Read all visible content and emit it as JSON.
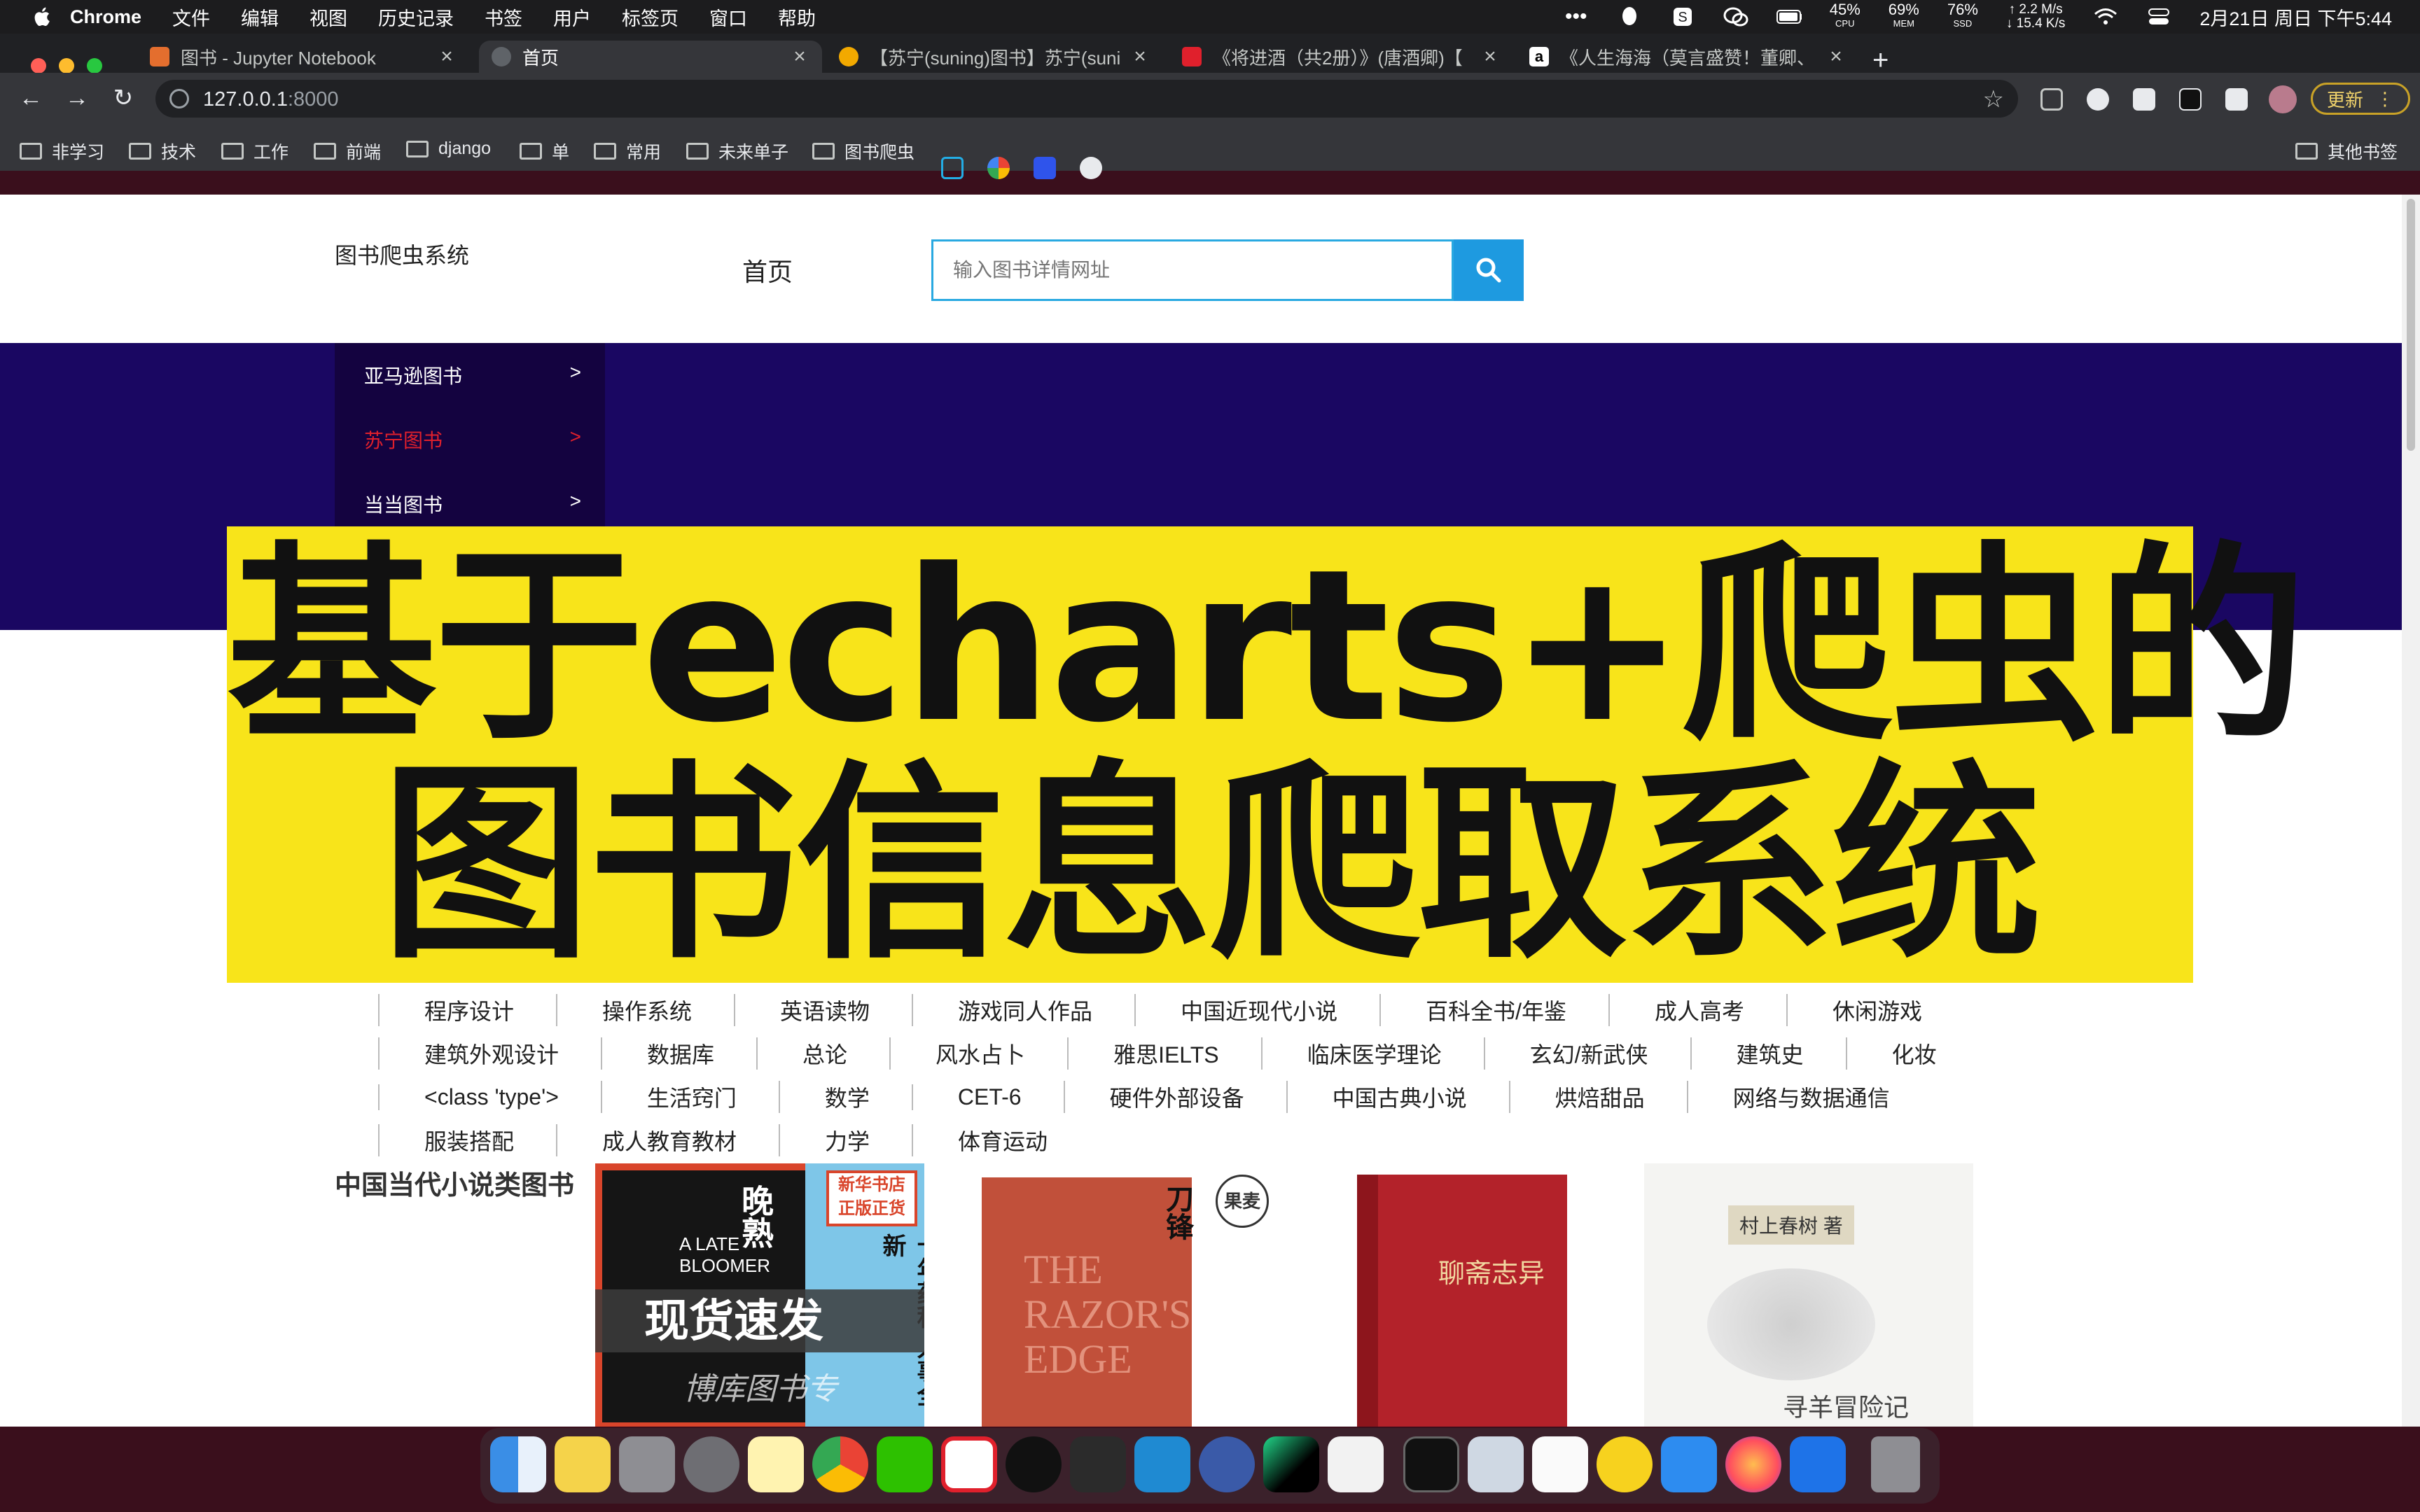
{
  "menubar": {
    "app_name": "Chrome",
    "items": [
      "文件",
      "编辑",
      "视图",
      "历史记录",
      "书签",
      "用户",
      "标签页",
      "窗口",
      "帮助"
    ],
    "cpu": "45%",
    "cpu_label": "CPU",
    "mem": "69%",
    "mem_label": "MEM",
    "ssd": "76%",
    "ssd_label": "SSD",
    "net_up": "↑ 2.2 M/s",
    "net_down": "↓ 15.4 K/s",
    "datetime": "2月21日 周日 下午5:44"
  },
  "tabs": [
    {
      "title": "图书 - Jupyter Notebook",
      "favicon_color": "#e46e2e",
      "active": false
    },
    {
      "title": "首页",
      "favicon_color": "#5f6368",
      "active": true
    },
    {
      "title": "【苏宁(suning)图书】苏宁(suni",
      "favicon_color": "#f2a900",
      "active": false
    },
    {
      "title": "《将进酒（共2册）》(唐酒卿)【",
      "favicon_color": "#e0202c",
      "active": false
    },
    {
      "title": "《人生海海（莫言盛赞！董卿、",
      "favicon_color": "#ffffff",
      "active": false
    }
  ],
  "omnibox": {
    "url_host": "127.0.0.1",
    "url_port": ":8000"
  },
  "update_label": "更新",
  "bookmarks": [
    "非学习",
    "技术",
    "工作",
    "前端",
    "django",
    "单",
    "常用",
    "未来单子",
    "图书爬虫"
  ],
  "other_bookmarks": "其他书签",
  "site": {
    "brand": "图书爬虫系统",
    "nav_home": "首页",
    "search_placeholder": "输入图书详情网址",
    "side_menu": [
      {
        "label": "亚马逊图书",
        "arrow": ">"
      },
      {
        "label": "苏宁图书",
        "arrow": ">"
      },
      {
        "label": "当当图书",
        "arrow": ">"
      }
    ],
    "overlay_line1": "基于echarts+爬虫的",
    "overlay_line2": "图书信息爬取系统",
    "categories": [
      [
        "程序设计",
        "操作系统",
        "英语读物",
        "游戏同人作品",
        "中国近现代小说",
        "百科全书/年鉴",
        "成人高考",
        "休闲游戏"
      ],
      [
        "建筑外观设计",
        "数据库",
        "总论",
        "风水占卜",
        "雅思IELTS",
        "临床医学理论",
        "玄幻/新武侠",
        "建筑史",
        "化妆"
      ],
      [
        "<class 'type'>",
        "生活窍门",
        "数学",
        "CET-6",
        "硬件外部设备",
        "中国古典小说",
        "烘焙甜品",
        "网络与数据通信"
      ],
      [
        "服装搭配",
        "成人教育教材",
        "力学",
        "体育运动"
      ]
    ],
    "section_title": "中国当代小说类图书",
    "books": [
      {
        "cover_title": "晚熟",
        "cover_subtitle": "A LATE BLOOMER",
        "badge": "新华书店 正版正货",
        "side_text": "十年蕴积 人事全新",
        "banner": "现货速发",
        "shop": "博库图书专"
      },
      {
        "cover_title": "刀锋",
        "cover_subtitle": "THE RAZOR'S EDGE",
        "badge": "果麦"
      },
      {
        "cover_title": "聊斋志异"
      },
      {
        "cover_title": "寻羊冒险记",
        "author": "村上春树 著"
      }
    ]
  }
}
